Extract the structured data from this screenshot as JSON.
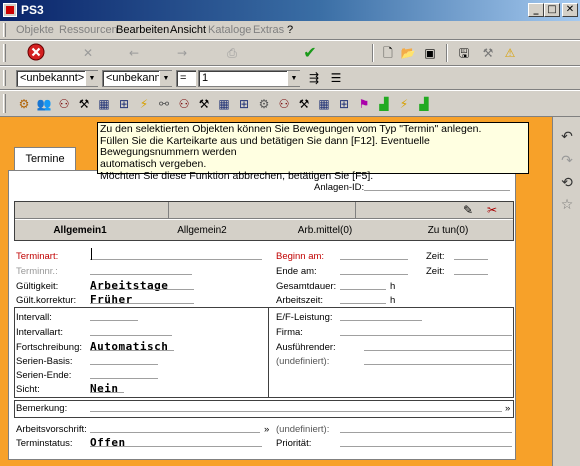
{
  "window": {
    "title": "PS3",
    "btn_min": "_",
    "btn_max": "□",
    "btn_close": "✕"
  },
  "menu": [
    {
      "label": "Objekte",
      "disabled": true
    },
    {
      "label": "Ressourcen",
      "disabled": true
    },
    {
      "label": "Bearbeiten",
      "disabled": false
    },
    {
      "label": "Ansicht",
      "disabled": false
    },
    {
      "label": "Kataloge",
      "disabled": true
    },
    {
      "label": "Extras",
      "disabled": true
    },
    {
      "label": "?",
      "disabled": false
    }
  ],
  "filters": {
    "combo1": "<unbekannt>",
    "combo2": "<unbekannt>",
    "operator": "=",
    "combo3": "1"
  },
  "tooltip": {
    "line1": "Zu den selektierten Objekten können Sie Bewegungen vom Typ \"Termin\" anlegen.",
    "line2": "Füllen Sie die Karteikarte aus und betätigen Sie dann [F12]. Eventuelle Bewegungsnummern werden",
    "line3": "automatisch vergeben.",
    "line4": "Möchten Sie diese Funktion abbrechen, betätigen Sie [F5]."
  },
  "tab": {
    "label": "Termine"
  },
  "panel": {
    "anlagen_id_label": "Anlagen-ID:",
    "subtabs": [
      "Allgemein1",
      "Allgemein2",
      "Arb.mittel(0)",
      "Zu tun(0)"
    ],
    "fields": {
      "terminart": "Terminart:",
      "terminnr": "Terminnr.:",
      "gueltigkeit": "Gültigkeit:",
      "gueltigkeit_val": "Arbeitstage",
      "guelt_korrektur": "Gült.korrektur:",
      "guelt_korrektur_val": "Früher",
      "beginn_am": "Beginn am:",
      "ende_am": "Ende am:",
      "gesamtdauer": "Gesamtdauer:",
      "arbeitszeit": "Arbeitszeit:",
      "h1": "h",
      "h2": "h",
      "zeit1": "Zeit:",
      "zeit2": "Zeit:",
      "intervall": "Intervall:",
      "intervallart": "Intervallart:",
      "fortschreibung": "Fortschreibung:",
      "fortschreibung_val": "Automatisch",
      "serien_basis": "Serien-Basis:",
      "serien_ende": "Serien-Ende:",
      "sicht": "Sicht:",
      "sicht_val": "Nein",
      "ef_leistung": "E/F-Leistung:",
      "firma": "Firma:",
      "ausfuehrender": "Ausführender:",
      "undefiniert1": "(undefiniert):",
      "bemerkung": "Bemerkung:",
      "arbeitsvorschrift": "Arbeitsvorschrift:",
      "terminstatus": "Terminstatus:",
      "terminstatus_val": "Offen",
      "undefiniert2": "(undefiniert):",
      "prioritaet": "Priorität:",
      "more1": "»",
      "more2": "»"
    }
  }
}
